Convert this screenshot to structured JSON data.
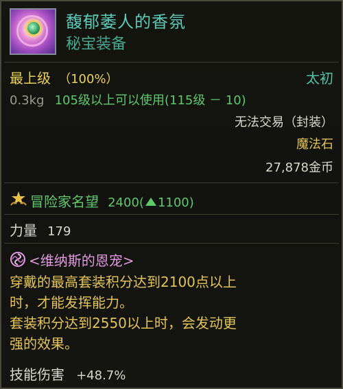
{
  "item": {
    "name": "馥郁萎人的香氛",
    "type": "秘宝装备",
    "icon": "perfume-charm-icon"
  },
  "grade": {
    "label": "最上级",
    "percent": "（100%）",
    "rarity": "太初"
  },
  "info": {
    "weight": "0.3kg",
    "level_req": "105级以上可以使用(115级 － 10)",
    "trade": "无法交易（封装）",
    "material": "魔法石",
    "price": "27,878金币"
  },
  "fame": {
    "label": "冒险家名望",
    "value": "2400(",
    "increase": "1100)",
    "icon": "medal-icon"
  },
  "stats": {
    "label": "力量",
    "value": "179"
  },
  "set": {
    "name": "<维纳斯的恩宠>",
    "icon": "swirl-icon",
    "lines": [
      "穿戴的最高套装积分达到2100点以上",
      "时，才能发挥能力。",
      "套装积分达到2550以上时，会发动更",
      "强的效果。"
    ],
    "bonus_label": "技能伤害",
    "bonus_value": "+48.7%"
  },
  "colors": {
    "name": "#5dc9b9",
    "grade": "#ead25a",
    "green": "#5ec96a",
    "gold": "#e3c457"
  }
}
